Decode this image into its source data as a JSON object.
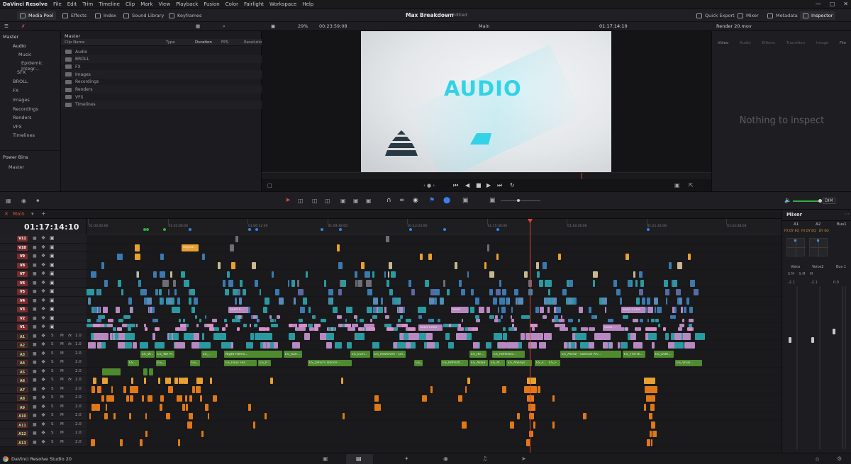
{
  "menubar": {
    "app": "DaVinci Resolve",
    "items": [
      "File",
      "Edit",
      "Trim",
      "Timeline",
      "Clip",
      "Mark",
      "View",
      "Playback",
      "Fusion",
      "Color",
      "Fairlight",
      "Workspace",
      "Help"
    ]
  },
  "toolbar": {
    "media_pool": "Media Pool",
    "effects": "Effects",
    "index": "Index",
    "sound_library": "Sound Library",
    "keyframes": "Keyframes",
    "project_title": "Max Breakdown",
    "edited": "Edited",
    "quick_export": "Quick Export",
    "mixer": "Mixer",
    "metadata": "Metadata",
    "inspector": "Inspector"
  },
  "viewer": {
    "zoom": "29%",
    "source_tc": "00:23:59:08",
    "timeline_name": "Main",
    "record_tc": "01:17:14:10",
    "frame_text": "AUDIO"
  },
  "inspector": {
    "clip_name": "Render 20.mov",
    "tabs": [
      "Video",
      "Audio",
      "Effects",
      "Transition",
      "Image",
      "File"
    ],
    "empty_text": "Nothing to inspect"
  },
  "bins": {
    "root": "Master",
    "tree": [
      "Audio",
      "Music",
      "Epidemic Integr...",
      "SFX",
      "BROLL",
      "FX",
      "Images",
      "Recordings",
      "Renders",
      "VFX",
      "Timelines"
    ],
    "power_bins": "Power Bins",
    "power_master": "Master"
  },
  "pool": {
    "header": "Master",
    "columns": [
      "Clip Name",
      "Type",
      "Duration",
      "FPS",
      "Resolution"
    ],
    "rows": [
      "Audio",
      "BROLL",
      "FX",
      "Images",
      "Recordings",
      "Renders",
      "VFX",
      "Timelines"
    ]
  },
  "timeline": {
    "tab": "Main",
    "timecode": "01:17:14:10",
    "ruler": [
      "01:00:00:00",
      "01:03:06:00",
      "01:06:12:00",
      "01:09:18:00",
      "01:12:24:00",
      "01:15:30:00",
      "01:18:36:00",
      "01:21:42:00",
      "01:24:48:00"
    ],
    "video_tracks": [
      "V11",
      "V10",
      "V9",
      "V8",
      "V7",
      "V6",
      "V5",
      "V4",
      "V3",
      "V2",
      "V1"
    ],
    "audio_tracks": [
      "A1",
      "A2",
      "A3",
      "A4",
      "A5",
      "A6",
      "A7",
      "A8",
      "A9",
      "A10",
      "A11",
      "A12",
      "A13"
    ],
    "audio_levels": [
      "1.0",
      "1.0",
      "2.0",
      "2.0",
      "2.0",
      "2.0",
      "2.0",
      "2.0",
      "2.0",
      "2.0",
      "2.0",
      "2.0",
      "2.0"
    ],
    "clip_labels": {
      "v10": "Adjust...",
      "v3a": "Solid C...",
      "v3b": "Solid ...",
      "v3c": "Solid Color",
      "v1a": "Solid Color",
      "v1b": "Solid ...",
      "a3": [
        "ES_W...",
        "ES_We Pl...",
        "ES_...",
        "Night Palms...",
        "ES_Sun...",
        "ES_Ever...",
        "ES_Reserves - Gri...",
        "ES_Re...",
        "ES_Reflectio...",
        "ES_Astral - Samuel An...",
        "ES_The Bi...",
        "ES_DOK..."
      ],
      "a4": [
        "ES...",
        "ES_...",
        "ES_...",
        "ES_Faux Fas...",
        "ES_P...",
        "ES_Devil's Dance -...",
        "ES_...",
        "ES_Reflecti...",
        "ES_Akwa...",
        "ES_Al...",
        "ES_Always...",
        "ES_F...",
        "ES_F...",
        "ES_Vivai..."
      ]
    }
  },
  "mixer": {
    "title": "Mixer",
    "channels": [
      "A1",
      "A2",
      "Bus1"
    ],
    "names": [
      "Voice",
      "Voice2",
      "Bus 1"
    ],
    "levels": [
      "-2.1",
      "-2.1",
      "0.0"
    ],
    "dim": "DIM"
  },
  "statusbar": {
    "app": "DaVinci Resolve Studio 20"
  }
}
